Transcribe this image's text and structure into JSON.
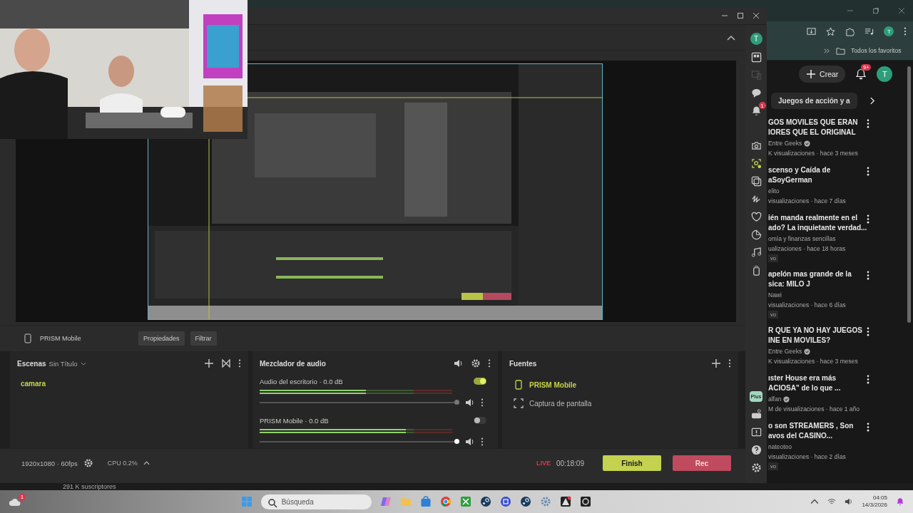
{
  "prism": {
    "source_bar": {
      "source": "PRISM Mobile",
      "buttons": [
        "Propiedades",
        "Filtrar"
      ]
    },
    "scenes": {
      "title": "Escenas",
      "collection": "Sin Título",
      "items": [
        {
          "name": "camara",
          "selected": true
        }
      ]
    },
    "mixer": {
      "title": "Mezclador de audio",
      "channels": [
        {
          "label": "Audio del escritorio · 0.0 dB",
          "on": true,
          "meter": {
            "level": 0.55
          },
          "volume": {
            "level": 0.99
          }
        },
        {
          "label": "PRISM Mobile · 0.0 dB",
          "on": false,
          "meter": {
            "level": 0.76
          },
          "volume": {
            "level": 0.99
          }
        }
      ]
    },
    "sources": {
      "title": "Fuentes",
      "items": [
        {
          "name": "PRISM Mobile",
          "kind": "mobile",
          "selected": true
        },
        {
          "name": "Captura de pantalla",
          "kind": "screen",
          "selected": false
        }
      ]
    },
    "footer": {
      "output": "1920x1080 · 60fps",
      "cpu": "CPU 0.2%",
      "live_label": "LIVE",
      "elapsed": "00:18:09",
      "buttons": [
        {
          "label": "Finish",
          "kind": "finish"
        },
        {
          "label": "Rec",
          "kind": "rec"
        }
      ]
    },
    "sidebar": {
      "avatar": "T",
      "notifications": "1",
      "plus": "Plus"
    }
  },
  "browser": {
    "avatar": "T",
    "bookmarks": "Todos los favoritos",
    "create": "Crear",
    "notifications": "9+",
    "channel_avatar": "T",
    "chip": "Juegos de acción y a",
    "videos": [
      {
        "title_lines": [
          "GOS MOVILES QUE ERAN",
          "IORES QUE EL ORIGINAL"
        ],
        "channel": "Entre Geeks",
        "verified": true,
        "meta": "K visualizaciones · hace 3 meses"
      },
      {
        "title_lines": [
          "scenso y Caída de",
          "aSoyGerman"
        ],
        "channel": "elito",
        "verified": false,
        "meta": "visualizaciones · hace 7 días"
      },
      {
        "title_lines": [
          "ién manda realmente en el",
          "ado? La inquietante verdad..."
        ],
        "channel": "omía y finanzas sencillas",
        "verified": false,
        "meta": "ualizaciones · hace 18 horas",
        "badge": "vo"
      },
      {
        "title_lines": [
          "apelón mas grande de la",
          "sica: MILO J"
        ],
        "channel": "Nawi",
        "verified": false,
        "meta": "visualizaciones · hace 6 días",
        "badge": "vo"
      },
      {
        "title_lines": [
          "R QUE YA NO HAY JUEGOS",
          "INE EN MOVILES?"
        ],
        "channel": "Entre Geeks",
        "verified": true,
        "meta": "K visualizaciones · hace 3 meses"
      },
      {
        "title_lines": [
          "ıster House era más",
          "ACIOSA\" de lo que ..."
        ],
        "channel": "alfan",
        "verified": true,
        "meta": "M de visualizaciones · hace 1 año"
      },
      {
        "title_lines": [
          "o son STREAMERS , Son",
          "avos del CASINO..."
        ],
        "channel": "nateoteo",
        "verified": false,
        "meta": "visualizaciones · hace 2 días",
        "badge": "vo"
      }
    ]
  },
  "taskbar": {
    "behind_text": "291 K suscriptores",
    "weather_badge": "1",
    "search_placeholder": "Búsqueda",
    "time": "04:05",
    "date": "14/3/2026"
  }
}
